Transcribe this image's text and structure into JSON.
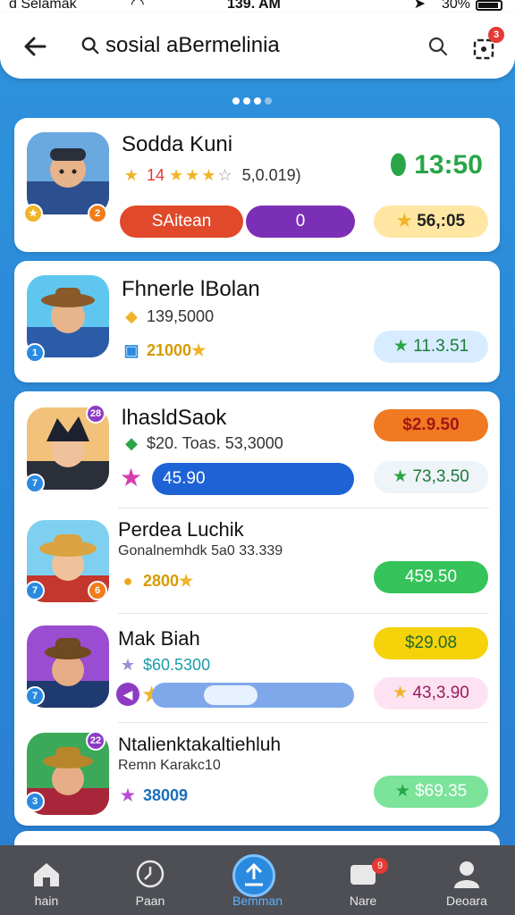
{
  "status_bar": {
    "carrier": "d Selamak",
    "time": "139. AM",
    "battery": "30%"
  },
  "search": {
    "query": "sosial aBermelinia",
    "filter_badge": "3"
  },
  "pager": {
    "total": 4,
    "active": 0
  },
  "cards": [
    {
      "name": "Sodda Kuni",
      "level_left": "",
      "level_right": "2",
      "rating_text": "14",
      "rating_value": "5,0.019)",
      "price": "13:50",
      "btn_primary": "SAitean",
      "btn_secondary": "0",
      "coins": "56,:05"
    },
    {
      "name": "Fhnerle lBolan",
      "level_left": "1",
      "stat1": "139,5000",
      "stat2": "21000",
      "price_pill": "11.3.51"
    },
    {
      "name": "lhasldSaok",
      "level_left": "7",
      "level_top": "28",
      "stat1": "$20. Toas.  53,3000",
      "progress_label": "45.90",
      "price_pill_top": "$2.9.50",
      "price_pill": "73,3.50",
      "sub": [
        {
          "name": "Perdea Luchik",
          "subtitle": "Gonalnemhdk 5a0 33.339",
          "level_left": "7",
          "level_right": "6",
          "stat": "2800",
          "price_pill": "459.50"
        },
        {
          "name": "Mak Biah",
          "level_left": "7",
          "stat": "$60.5300",
          "slider_value": 0.35,
          "price_pill_top": "$29.08",
          "price_pill": "43,3.90"
        },
        {
          "name": "Ntalienktakaltiehluh",
          "subtitle": "Remn Karakc10",
          "level_left": "3",
          "level_top": "22",
          "stat": "38009",
          "price_pill": "$69.35"
        }
      ]
    }
  ],
  "tabs": [
    {
      "label": "hain"
    },
    {
      "label": "Paan"
    },
    {
      "label": "Bemman"
    },
    {
      "label": "Nare",
      "badge": "9"
    },
    {
      "label": "Deoara"
    }
  ],
  "colors": {
    "accent": "#2a8ae0",
    "price_green": "#2aa547",
    "btn_red": "#e0492a",
    "btn_purple": "#7b2fb6",
    "pill_yellow": "#ffe7a3",
    "pill_blue": "#d7edff",
    "pill_orange": "#ef7a22",
    "pill_green": "#35c35a",
    "pill_yellow_strong": "#f5d20a",
    "pill_pink": "#fde2f2"
  }
}
